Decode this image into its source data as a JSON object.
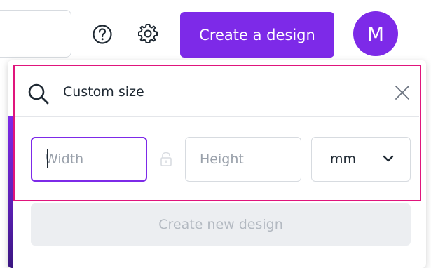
{
  "header": {
    "create_button_label": "Create a design",
    "avatar_initial": "M",
    "help_icon": "question-circle-icon",
    "settings_icon": "gear-icon"
  },
  "dropdown": {
    "search": {
      "value": "Custom size",
      "icon": "search-icon",
      "close_icon": "close-icon"
    },
    "width_field": {
      "placeholder": "Width",
      "value": ""
    },
    "height_field": {
      "placeholder": "Height",
      "value": ""
    },
    "lock_icon": "lock-icon",
    "unit_select": {
      "selected": "mm"
    },
    "create_new_label": "Create new design"
  },
  "colors": {
    "brand_purple": "#7d2ae8",
    "highlight_pink": "#e0157c",
    "disabled_bg": "#eceef1",
    "disabled_text": "#b3b9c1"
  }
}
